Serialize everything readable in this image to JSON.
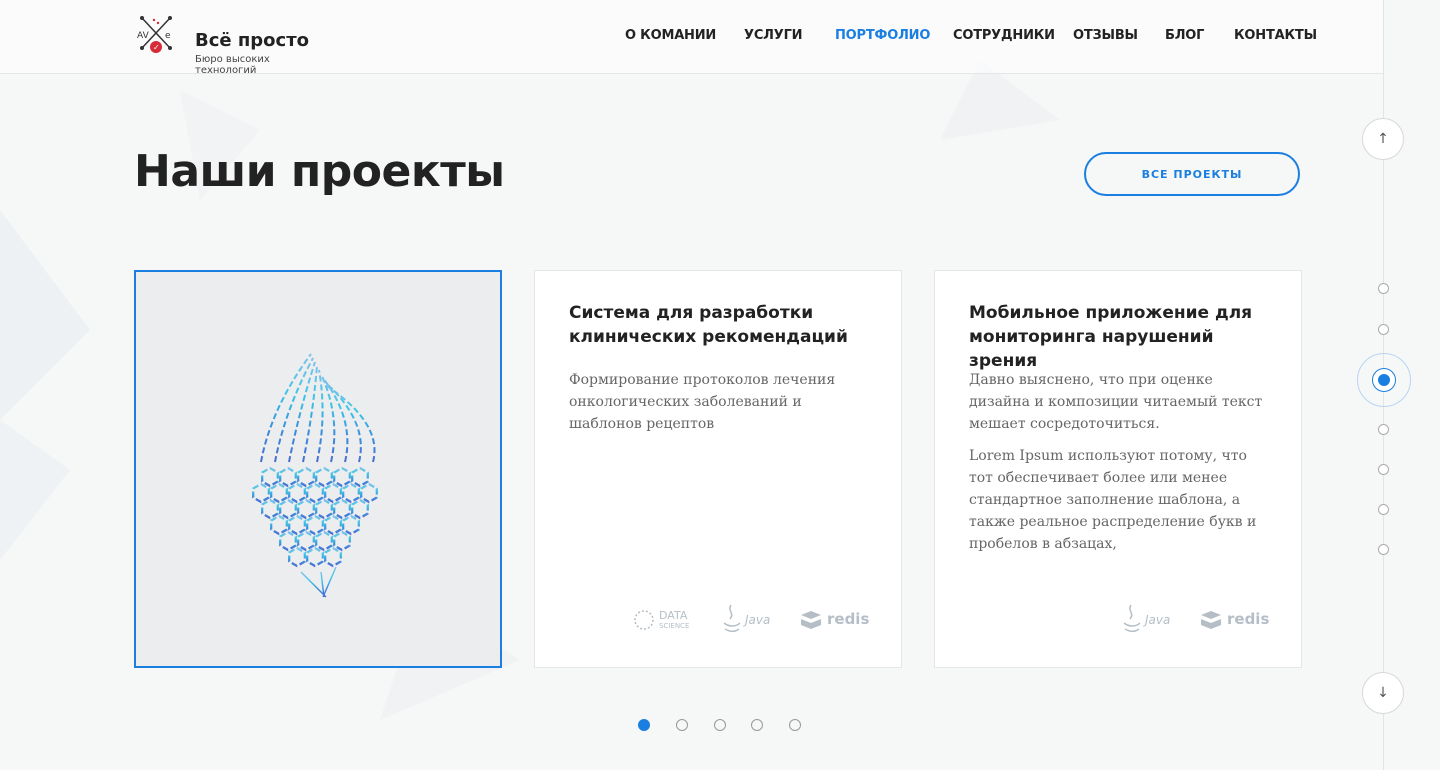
{
  "brand": {
    "title": "Всё просто",
    "subtitle": "Бюро высоких технологий",
    "mark_text": "AVe"
  },
  "nav": {
    "items": [
      {
        "label": "О КОМАНИИ",
        "active": false
      },
      {
        "label": "УСЛУГИ",
        "active": false
      },
      {
        "label": "ПОРТФОЛИО",
        "active": true
      },
      {
        "label": "СОТРУДНИКИ",
        "active": false
      },
      {
        "label": "ОТЗЫВЫ",
        "active": false
      },
      {
        "label": "БЛОГ",
        "active": false
      },
      {
        "label": "КОНТАКТЫ",
        "active": false
      }
    ]
  },
  "section": {
    "title": "Наши проекты",
    "all_projects_label": "ВСЕ ПРОЕКТЫ"
  },
  "cards": [
    {
      "title": "Система для разработки клинических рекомендаций",
      "paragraphs": [
        "Формирование протоколов лечения онкологических заболеваний и шаблонов рецептов"
      ],
      "tech": [
        "DATA SCIENCE",
        "Java",
        "redis"
      ]
    },
    {
      "title": "Мобильное приложение для мониторинга нарушений зрения",
      "paragraphs": [
        "Давно выяснено, что при оценке дизайна и композиции читаемый текст мешает сосредоточиться.",
        "Lorem Ipsum используют потому, что тот обеспечивает более или менее стандартное заполнение шаблона, а также реальное распределение букв и пробелов в абзацах,"
      ],
      "tech": [
        "Java",
        "redis"
      ]
    }
  ],
  "tech_labels": {
    "data_top": "DATA",
    "data_bottom": "SCIENCE",
    "java": "Java",
    "redis": "redis"
  },
  "side_nav": {
    "up_icon": "↑",
    "down_icon": "↓",
    "dots": 7,
    "active_dot": 2
  },
  "pager": {
    "count": 5,
    "active": 0
  },
  "colors": {
    "accent": "#1a7fe0",
    "text": "#222222",
    "muted": "#666666",
    "card_image_bg": "#ecedef"
  }
}
